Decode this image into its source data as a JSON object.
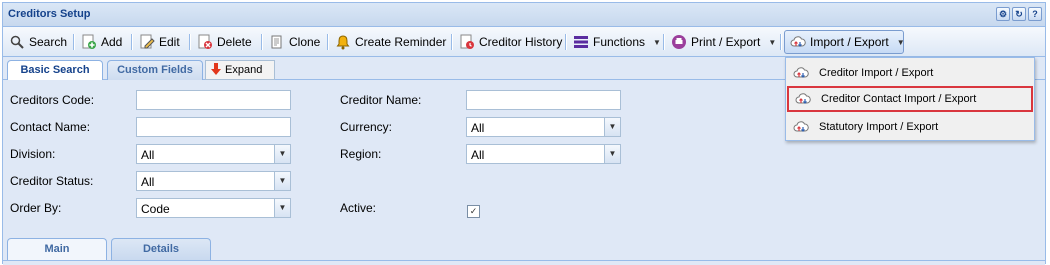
{
  "window": {
    "title": "Creditors Setup",
    "tool_icons": [
      "gear-icon",
      "refresh-icon",
      "help-icon"
    ],
    "help_glyph": "?"
  },
  "toolbar": {
    "search": "Search",
    "add": "Add",
    "edit": "Edit",
    "delete": "Delete",
    "clone": "Clone",
    "create_reminder": "Create Reminder",
    "creditor_history": "Creditor History",
    "functions": "Functions",
    "print_export": "Print / Export",
    "import_export": "Import / Export"
  },
  "tabs": {
    "basic_search": "Basic Search",
    "custom_fields": "Custom Fields",
    "expand": "Expand"
  },
  "form": {
    "creditors_code": {
      "label": "Creditors Code:",
      "value": ""
    },
    "contact_name": {
      "label": "Contact Name:",
      "value": ""
    },
    "division": {
      "label": "Division:",
      "value": "All"
    },
    "creditor_status": {
      "label": "Creditor Status:",
      "value": "All"
    },
    "order_by": {
      "label": "Order By:",
      "value": "Code"
    },
    "creditor_name": {
      "label": "Creditor Name:",
      "value": ""
    },
    "currency": {
      "label": "Currency:",
      "value": "All"
    },
    "region": {
      "label": "Region:",
      "value": "All"
    },
    "active": {
      "label": "Active:",
      "checked": true
    }
  },
  "bottom_tabs": {
    "main": "Main",
    "details": "Details"
  },
  "import_export_menu": {
    "items": [
      {
        "label": "Creditor Import / Export",
        "highlighted": false
      },
      {
        "label": "Creditor Contact Import / Export",
        "highlighted": true
      },
      {
        "label": "Statutory Import / Export",
        "highlighted": false
      }
    ]
  },
  "colors": {
    "accent": "#15428b",
    "highlight_border": "#d9363e",
    "panel_bg": "#dfe8f6"
  }
}
